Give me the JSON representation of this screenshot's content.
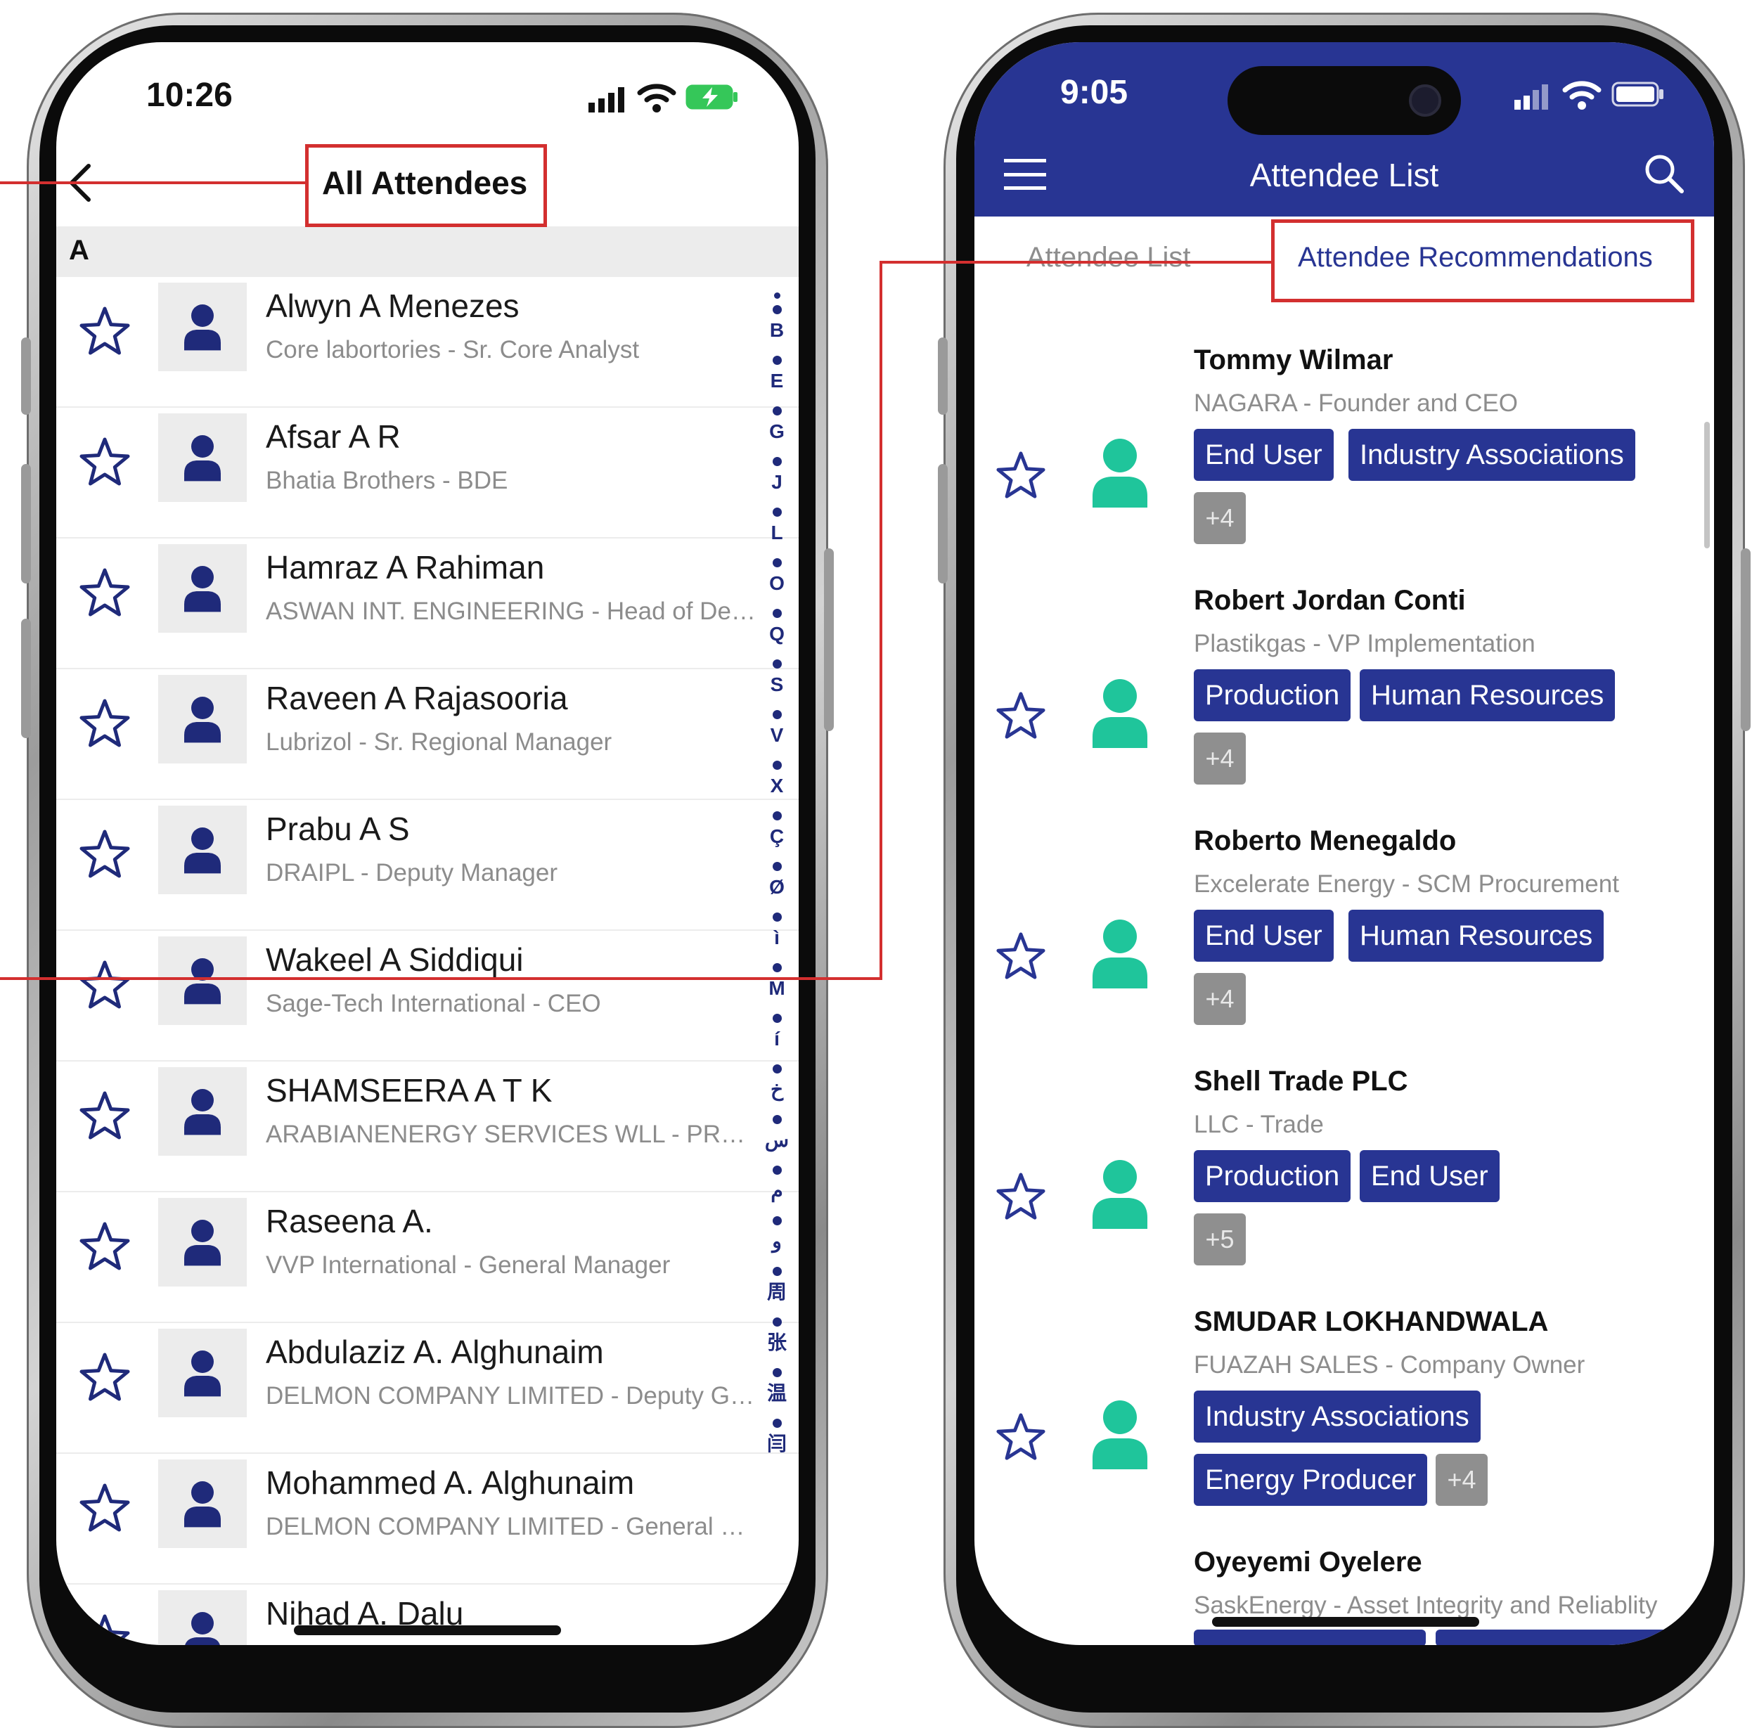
{
  "left_phone": {
    "status": {
      "time": "10:26"
    },
    "nav": {
      "title": "All Attendees"
    },
    "section_letter": "A",
    "attendees": [
      {
        "name": "Alwyn A Menezes",
        "subtitle": "Core labortories - Sr. Core Analyst"
      },
      {
        "name": "Afsar A R",
        "subtitle": "Bhatia Brothers - BDE"
      },
      {
        "name": "Hamraz A Rahiman",
        "subtitle": "ASWAN INT. ENGINEERING - Head of Depar..."
      },
      {
        "name": "Raveen A Rajasooria",
        "subtitle": "Lubrizol - Sr. Regional Manager"
      },
      {
        "name": "Prabu A S",
        "subtitle": "DRAIPL - Deputy Manager"
      },
      {
        "name": "Wakeel A Siddiqui",
        "subtitle": "Sage-Tech International - CEO"
      },
      {
        "name": "SHAMSEERA A T K",
        "subtitle": "ARABIANENERGY SERVICES WLL - PROCU..."
      },
      {
        "name": "Raseena A.",
        "subtitle": "VVP International - General Manager"
      },
      {
        "name": "Abdulaziz A. Alghunaim",
        "subtitle": "DELMON COMPANY LIMITED - Deputy Gen..."
      },
      {
        "name": "Mohammed A. Alghunaim",
        "subtitle": "DELMON COMPANY LIMITED - General Ma..."
      },
      {
        "name": "Nihad A. Dalu",
        "subtitle": ""
      }
    ],
    "index_letters": [
      "B",
      "E",
      "G",
      "J",
      "L",
      "O",
      "Q",
      "S",
      "V",
      "X",
      "Ç",
      "Ø",
      "ì",
      "M",
      "í",
      "خ",
      "س",
      "م",
      "و",
      "周",
      "张",
      "温",
      "闫"
    ]
  },
  "right_phone": {
    "status": {
      "time": "9:05"
    },
    "header": {
      "title": "Attendee List"
    },
    "tabs": {
      "list": "Attendee List",
      "recommendations": "Attendee Recommendations"
    },
    "recommendations": [
      {
        "name": "Tommy Wilmar",
        "subtitle": "NAGARA - Founder and CEO",
        "tags": [
          "End User",
          "Industry Associations"
        ],
        "more": "+4"
      },
      {
        "name": "Robert Jordan Conti",
        "subtitle": "Plastikgas - VP Implementation",
        "tags": [
          "Production",
          "Human Resources"
        ],
        "more": "+4"
      },
      {
        "name": "Roberto Menegaldo",
        "subtitle": "Excelerate Energy - SCM Procurement",
        "tags": [
          "End User",
          "Human Resources"
        ],
        "more": "+4"
      },
      {
        "name": "Shell Trade PLC",
        "subtitle": "LLC - Trade",
        "tags": [
          "Production",
          "End User"
        ],
        "more": "+5"
      },
      {
        "name": "SMUDAR LOKHANDWALA",
        "subtitle": "FUAZAH SALES - Company Owner",
        "tags": [
          "Industry Associations",
          "Energy Producer"
        ],
        "more": "+4"
      },
      {
        "name": "Oyeyemi Oyelere",
        "subtitle": "SaskEnergy - Asset Integrity and Reliablity",
        "tags": [],
        "more": ""
      }
    ]
  },
  "colors": {
    "navy": "#283593",
    "teal": "#1fc59b",
    "red": "#d32f2f",
    "gray_tag": "#8f8f8f"
  }
}
